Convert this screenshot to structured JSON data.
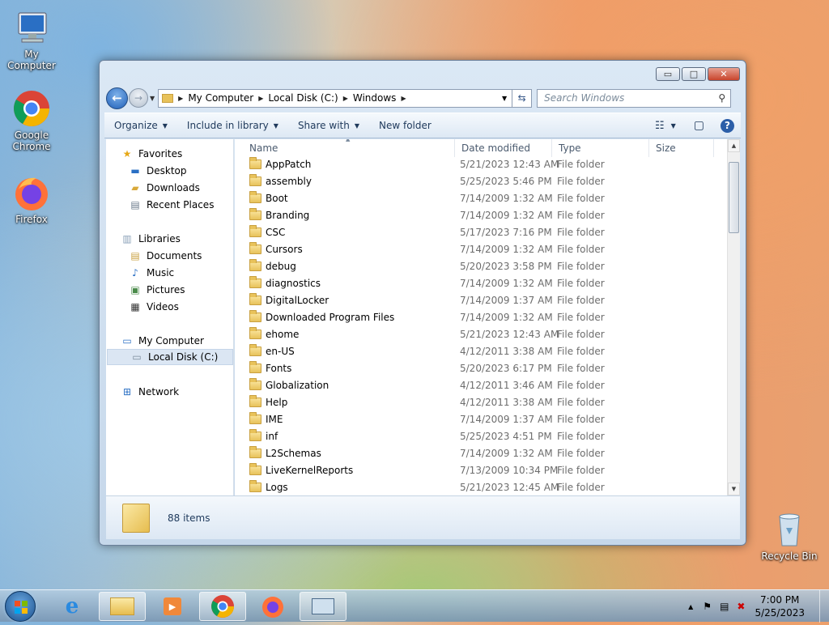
{
  "desktop": {
    "icons": [
      {
        "label": "My Computer"
      },
      {
        "label": "Google Chrome"
      },
      {
        "label": "Firefox"
      },
      {
        "label": "Recycle Bin"
      }
    ]
  },
  "window": {
    "controls": {
      "minimize": "▭",
      "maximize": "□",
      "close": "✕"
    }
  },
  "address": {
    "segments": [
      "My Computer",
      "Local Disk (C:)",
      "Windows"
    ]
  },
  "search": {
    "placeholder": "Search Windows"
  },
  "toolbar": {
    "organize": "Organize",
    "include": "Include in library",
    "share": "Share with",
    "new_folder": "New folder"
  },
  "nav": {
    "favorites": "Favorites",
    "desktop": "Desktop",
    "downloads": "Downloads",
    "recent": "Recent Places",
    "libraries": "Libraries",
    "documents": "Documents",
    "music": "Music",
    "pictures": "Pictures",
    "videos": "Videos",
    "computer": "My Computer",
    "localdisk": "Local Disk (C:)",
    "network": "Network"
  },
  "columns": {
    "name": "Name",
    "date": "Date modified",
    "type": "Type",
    "size": "Size"
  },
  "files": [
    {
      "name": "AppPatch",
      "date": "5/21/2023 12:43 AM",
      "type": "File folder"
    },
    {
      "name": "assembly",
      "date": "5/25/2023 5:46 PM",
      "type": "File folder"
    },
    {
      "name": "Boot",
      "date": "7/14/2009 1:32 AM",
      "type": "File folder"
    },
    {
      "name": "Branding",
      "date": "7/14/2009 1:32 AM",
      "type": "File folder"
    },
    {
      "name": "CSC",
      "date": "5/17/2023 7:16 PM",
      "type": "File folder"
    },
    {
      "name": "Cursors",
      "date": "7/14/2009 1:32 AM",
      "type": "File folder"
    },
    {
      "name": "debug",
      "date": "5/20/2023 3:58 PM",
      "type": "File folder"
    },
    {
      "name": "diagnostics",
      "date": "7/14/2009 1:32 AM",
      "type": "File folder"
    },
    {
      "name": "DigitalLocker",
      "date": "7/14/2009 1:37 AM",
      "type": "File folder"
    },
    {
      "name": "Downloaded Program Files",
      "date": "7/14/2009 1:32 AM",
      "type": "File folder"
    },
    {
      "name": "ehome",
      "date": "5/21/2023 12:43 AM",
      "type": "File folder"
    },
    {
      "name": "en-US",
      "date": "4/12/2011 3:38 AM",
      "type": "File folder"
    },
    {
      "name": "Fonts",
      "date": "5/20/2023 6:17 PM",
      "type": "File folder"
    },
    {
      "name": "Globalization",
      "date": "4/12/2011 3:46 AM",
      "type": "File folder"
    },
    {
      "name": "Help",
      "date": "4/12/2011 3:38 AM",
      "type": "File folder"
    },
    {
      "name": "IME",
      "date": "7/14/2009 1:37 AM",
      "type": "File folder"
    },
    {
      "name": "inf",
      "date": "5/25/2023 4:51 PM",
      "type": "File folder"
    },
    {
      "name": "L2Schemas",
      "date": "7/14/2009 1:32 AM",
      "type": "File folder"
    },
    {
      "name": "LiveKernelReports",
      "date": "7/13/2009 10:34 PM",
      "type": "File folder"
    },
    {
      "name": "Logs",
      "date": "5/21/2023 12:45 AM",
      "type": "File folder"
    }
  ],
  "status": {
    "count": "88 items"
  },
  "clock": {
    "time": "7:00 PM",
    "date": "5/25/2023"
  }
}
